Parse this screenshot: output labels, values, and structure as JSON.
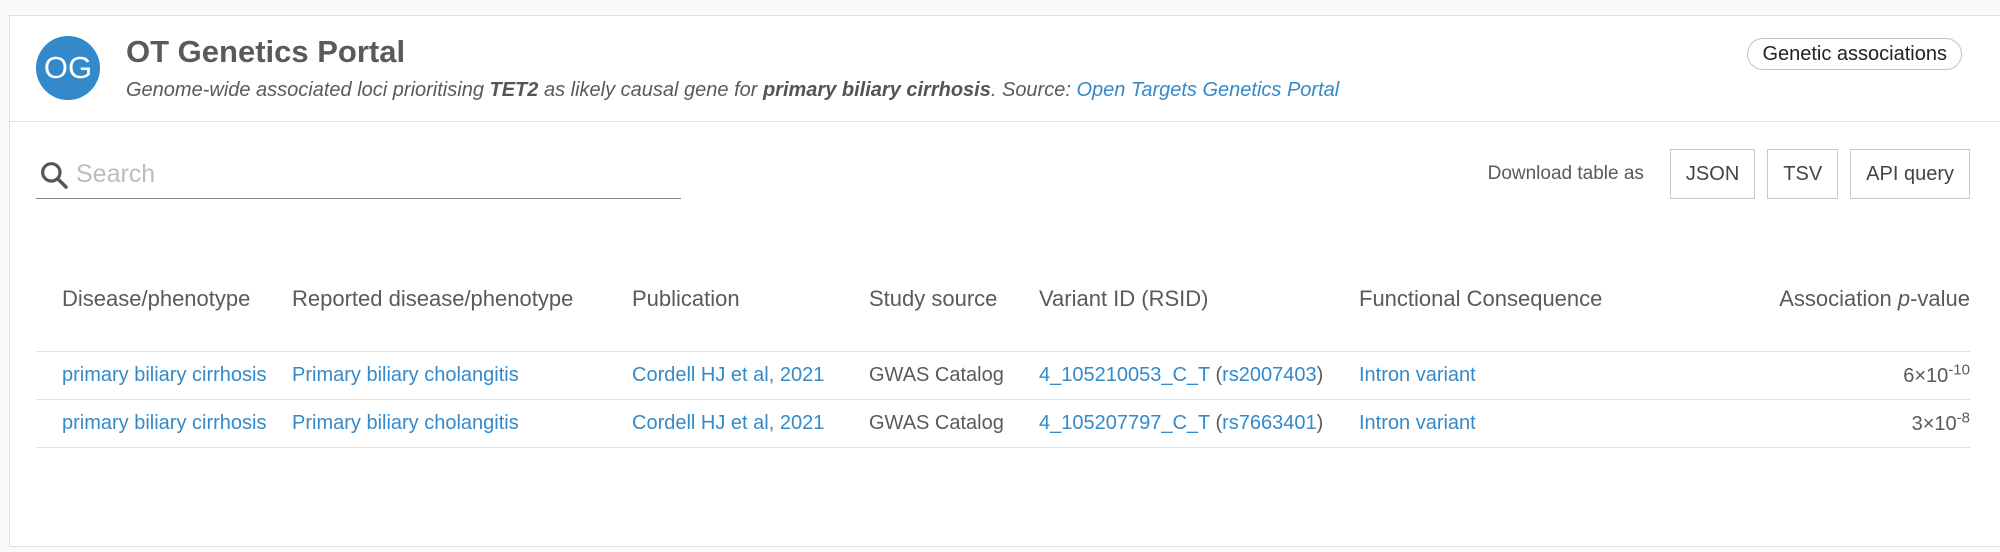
{
  "colors": {
    "accent": "#3489ca",
    "avatar_bg": "#3489ca",
    "text": "#5a5a5a"
  },
  "header": {
    "avatar_initials": "OG",
    "title": "OT Genetics Portal",
    "subtitle": {
      "prefix": "Genome-wide associated loci prioritising ",
      "gene": "TET2",
      "middle": " as likely causal gene for ",
      "disease": "primary biliary cirrhosis",
      "source_prefix": ". Source: ",
      "source_link": "Open Targets Genetics Portal"
    },
    "chip_label": "Genetic associations"
  },
  "search": {
    "placeholder": "Search",
    "value": "",
    "icon": "search-icon"
  },
  "downloads": {
    "label": "Download table as",
    "buttons": [
      "JSON",
      "TSV",
      "API query"
    ]
  },
  "table": {
    "columns": [
      "Disease/phenotype",
      "Reported disease/phenotype",
      "Publication",
      "Study source",
      "Variant ID (RSID)",
      "Functional Consequence",
      {
        "prefix": "Association ",
        "italic": "p",
        "suffix": "-value"
      }
    ],
    "rows": [
      {
        "disease": "primary biliary cirrhosis",
        "reported": "Primary biliary cholangitis",
        "publication": "Cordell HJ et al, 2021",
        "source": "GWAS Catalog",
        "variant_id": "4_105210053_C_T",
        "rsid": "rs2007403",
        "consequence": "Intron variant",
        "pvalue_mantissa": "6",
        "pvalue_exponent": "-10"
      },
      {
        "disease": "primary biliary cirrhosis",
        "reported": "Primary biliary cholangitis",
        "publication": "Cordell HJ et al, 2021",
        "source": "GWAS Catalog",
        "variant_id": "4_105207797_C_T",
        "rsid": "rs7663401",
        "consequence": "Intron variant",
        "pvalue_mantissa": "3",
        "pvalue_exponent": "-8"
      }
    ]
  }
}
